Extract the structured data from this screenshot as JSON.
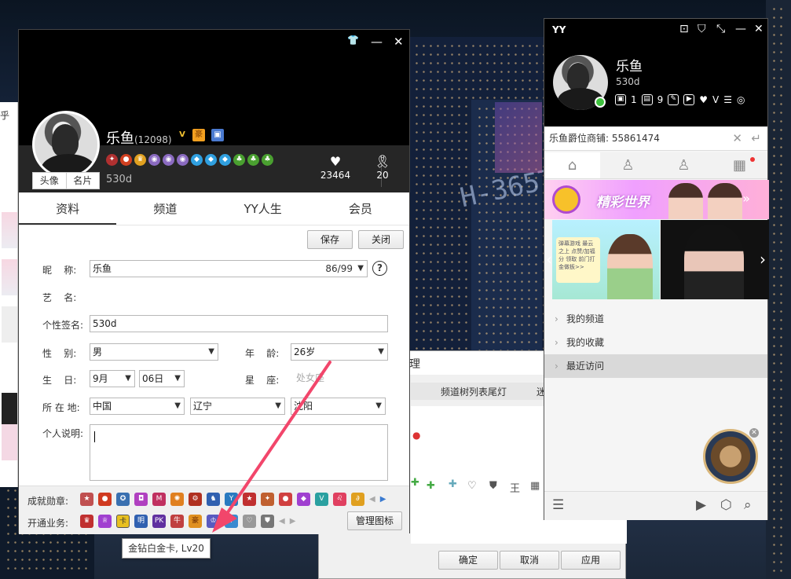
{
  "profile_window": {
    "shirt_icon": "shirt-icon",
    "minimize": "—",
    "close": "✕",
    "avatar_tab_head": "头像",
    "avatar_tab_card": "名片",
    "nickname": "乐鱼",
    "nickname_id": "(12098)",
    "yy_number": "530d",
    "likes_count": "23464",
    "level_count": "20",
    "tabs": [
      "资料",
      "频道",
      "YY人生",
      "会员"
    ],
    "save_button": "保存",
    "close_button": "关闭",
    "form": {
      "nickname_label": "昵    称:",
      "nickname_value": "乐鱼",
      "nickname_counter": "86/99",
      "art_name_label": "艺    名:",
      "signature_label": "个性签名:",
      "signature_value": "530d",
      "gender_label": "性    别:",
      "gender_value": "男",
      "age_label": "年    龄:",
      "age_value": "26岁",
      "birthday_label": "生    日:",
      "birth_month": "9月",
      "birth_day": "06日",
      "zodiac_label": "星    座:",
      "zodiac_value": "处女座",
      "location_label": "所 在 地:",
      "country": "中国",
      "province": "辽宁",
      "city": "沈阳",
      "bio_label": "个人说明:",
      "help_icon": "?"
    },
    "achievements_label": "成就勋章:",
    "services_label": "开通业务:",
    "manage_icons_button": "管理图标"
  },
  "tooltip": "金钻白金卡, Lv20",
  "background_dialog": {
    "title_fragment": "理",
    "tab_label": "频道树列表尾灯",
    "tab_label_2": "迷",
    "ok": "确定",
    "cancel": "取消",
    "apply": "应用"
  },
  "yy_window": {
    "title": "YY",
    "nickname": "乐鱼",
    "yy_number": "530d",
    "friends_count": "1",
    "gift_count": "9",
    "search_text": "乐鱼爵位商铺: 55861474",
    "banner_title": "精彩世界",
    "banner_card_text": "弹幕游戏 \n 最云之上 \n 点赞/加福分 \n 领取 前门打金做板>>",
    "menu": [
      "我的频道",
      "我的收藏",
      "最近访问"
    ]
  },
  "colors": {
    "accent_online": "#3ec13e",
    "tooltip_arrow": "#f2466b",
    "header_bg": "#000000"
  }
}
